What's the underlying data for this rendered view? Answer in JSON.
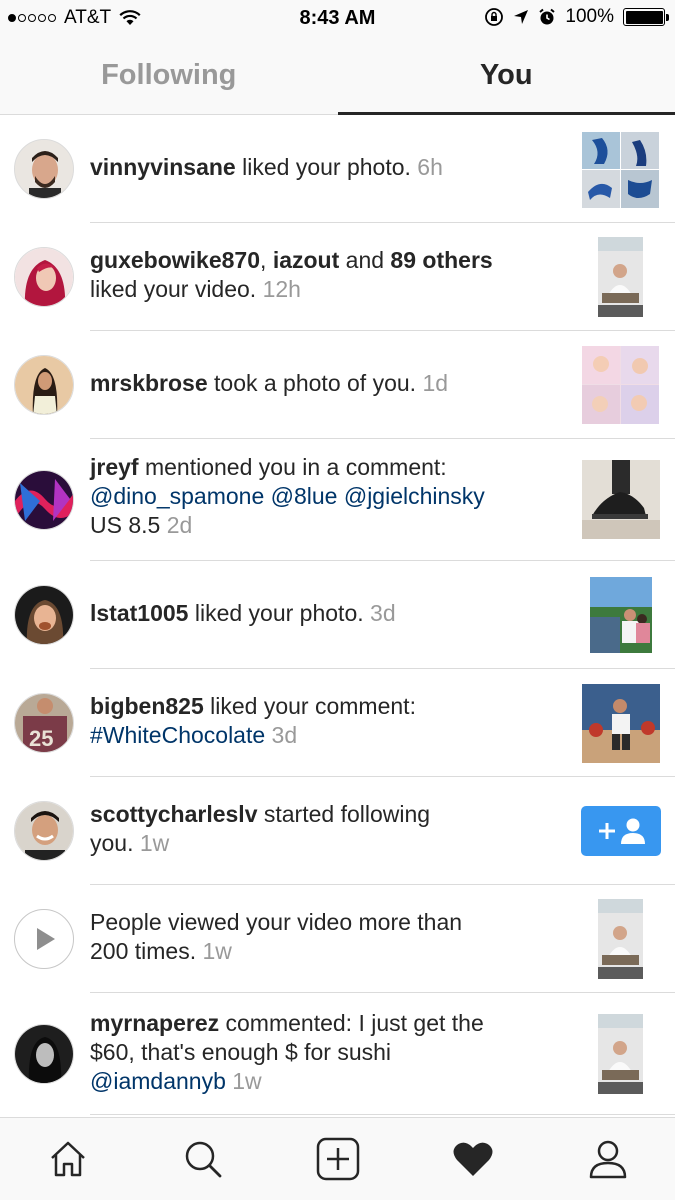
{
  "status": {
    "carrier": "AT&T",
    "time": "8:43 AM",
    "battery": "100%",
    "signal_bars": 1
  },
  "tabs": [
    {
      "label": "Following",
      "active": false
    },
    {
      "label": "You",
      "active": true
    }
  ],
  "notifications": [
    {
      "user": "vinnyvinsane",
      "action": " liked your photo.",
      "time": "6h"
    },
    {
      "user": "guxebowike870",
      "comma": ", ",
      "user2": "iazout",
      "and": " and ",
      "others": "89 others",
      "action": "liked your video.",
      "time": "12h"
    },
    {
      "user": "mrskbrose",
      "action": " took a photo of you.",
      "time": "1d"
    },
    {
      "user": "jreyf",
      "action": " mentioned you in a comment:",
      "mentions": "@dino_spamone @8lue @jgielchinsky",
      "extra": "US 8.5",
      "time": "2d"
    },
    {
      "user": "lstat1005",
      "action": " liked your photo.",
      "time": "3d"
    },
    {
      "user": "bigben825",
      "action": " liked your comment:",
      "hashtag": "#WhiteChocolate",
      "time": "3d"
    },
    {
      "user": "scottycharleslv",
      "action": " started following",
      "action2": "you.",
      "time": "1w"
    },
    {
      "text": "People viewed your video more than",
      "text2": "200 times.",
      "time": "1w"
    },
    {
      "user": "myrnaperez",
      "action": " commented: I just get the",
      "action2": "$60, that's enough $ for sushi",
      "mention": "@iamdannyb",
      "time": "1w"
    }
  ],
  "colors": {
    "link": "#003569",
    "timestamp": "#999999",
    "follow_button": "#3897f0",
    "separator": "#dbdbdb"
  },
  "icons": {
    "nav": [
      "home-icon",
      "search-icon",
      "add-post-icon",
      "heart-icon",
      "profile-icon"
    ],
    "follow": "add-user-icon",
    "play": "play-icon"
  }
}
